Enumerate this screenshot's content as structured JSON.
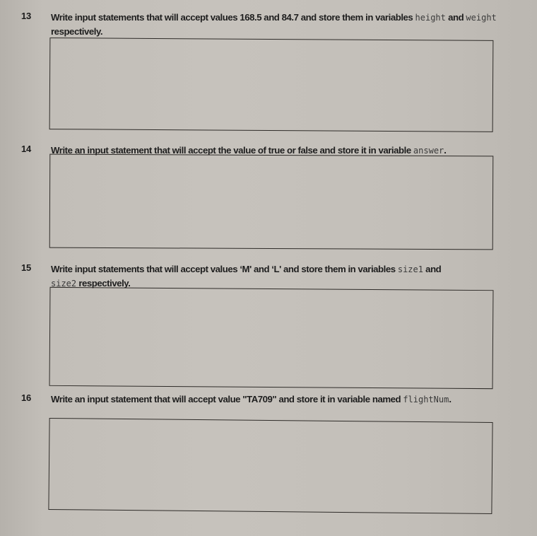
{
  "questions": [
    {
      "number": "13",
      "text_1": "Write input statements that will accept values 168.5 and 84.7 and store them in variables ",
      "code_1": "height",
      "text_2": " and ",
      "code_2": "weight",
      "text_3": " respectively.",
      "answer": ""
    },
    {
      "number": "14",
      "text_1": "Write an input statement that will accept the value of true or false and store it in variable ",
      "code_1": "answer",
      "text_2": ".",
      "answer": ""
    },
    {
      "number": "15",
      "text_1": "Write input statements that will accept values ‘M' and ‘L' and store them in variables ",
      "code_1": "size1",
      "text_2": " and ",
      "code_2": "size2",
      "text_3": " respectively.",
      "answer": ""
    },
    {
      "number": "16",
      "text_1": "Write an input statement that will accept value \"TA709\" and store it in variable named ",
      "code_1": "flightNum",
      "text_2": ".",
      "answer": ""
    }
  ],
  "colors": {
    "paper": "#c6c2bc",
    "ink": "#1e1e1e",
    "box_border": "#2e2b28"
  }
}
